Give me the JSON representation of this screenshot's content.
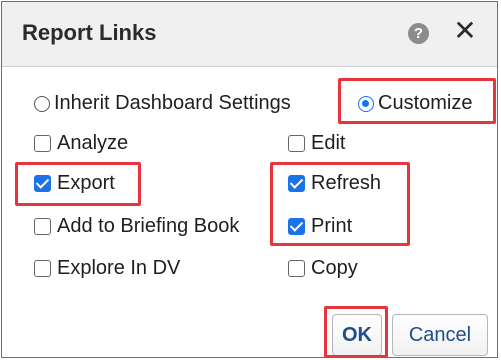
{
  "dialog": {
    "title": "Report Links",
    "help_icon": "question-mark-circle-icon",
    "close_icon": "close-icon",
    "help_glyph": "?",
    "close_glyph": "✕"
  },
  "mode": {
    "inherit_label": "Inherit Dashboard Settings",
    "customize_label": "Customize",
    "selected": "customize"
  },
  "options": [
    {
      "label": "Analyze",
      "checked": false
    },
    {
      "label": "Edit",
      "checked": false
    },
    {
      "label": "Export",
      "checked": true
    },
    {
      "label": "Refresh",
      "checked": true
    },
    {
      "label": "Add to Briefing Book",
      "checked": false
    },
    {
      "label": "Print",
      "checked": true
    },
    {
      "label": "Explore In DV",
      "checked": false
    },
    {
      "label": "Copy",
      "checked": false
    }
  ],
  "buttons": {
    "ok_label": "OK",
    "cancel_label": "Cancel"
  },
  "colors": {
    "highlight": "#e8343c",
    "accent": "#1a73e8",
    "button_text": "#1f4e8c"
  }
}
